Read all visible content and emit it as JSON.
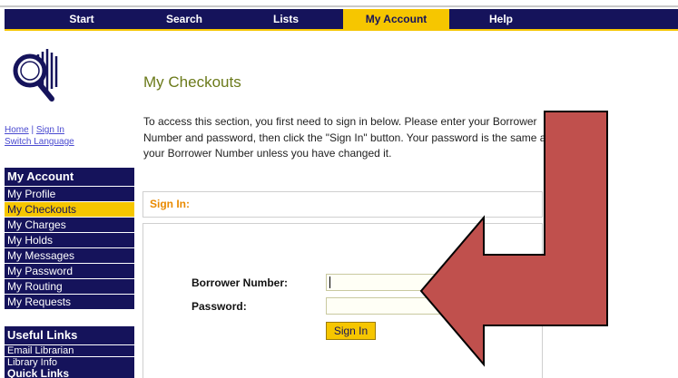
{
  "nav": {
    "tabs": [
      {
        "label": "Start"
      },
      {
        "label": "Search"
      },
      {
        "label": "Lists"
      },
      {
        "label": "My Account"
      },
      {
        "label": "Help"
      }
    ],
    "active": "My Account"
  },
  "header_links": {
    "home": "Home",
    "separator": "|",
    "sign_in": "Sign In",
    "switch_language": "Switch Language"
  },
  "sidebar": {
    "account_heading": "My Account",
    "account_items": [
      {
        "label": "My Profile"
      },
      {
        "label": "My Checkouts"
      },
      {
        "label": "My Charges"
      },
      {
        "label": "My Holds"
      },
      {
        "label": "My Messages"
      },
      {
        "label": "My Password"
      },
      {
        "label": "My Routing"
      },
      {
        "label": "My Requests"
      }
    ],
    "useful_heading": "Useful Links",
    "useful_items": [
      {
        "label": "Email Librarian"
      },
      {
        "label": "Library Info"
      }
    ],
    "quick_heading": "Quick Links"
  },
  "main": {
    "title": "My Checkouts",
    "intro": "To access this section, you first need to sign in below. Please enter your Borrower Number and password, then click the \"Sign In\" button. Your password is the same as your Borrower Number unless you have changed it.",
    "signin_heading": "Sign In:",
    "borrower_label": "Borrower Number:",
    "borrower_value": "",
    "password_label": "Password:",
    "password_value": "",
    "signin_button": "Sign In"
  },
  "colors": {
    "navy": "#15135b",
    "gold": "#f6c600",
    "arrow": "#c0504d"
  }
}
